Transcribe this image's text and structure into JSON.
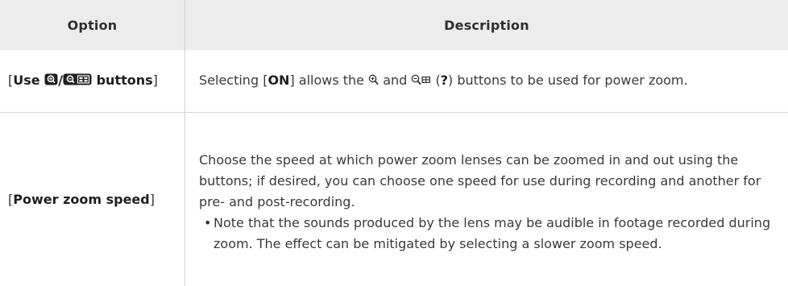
{
  "table": {
    "headers": {
      "option": "Option",
      "description": "Description"
    },
    "rows": [
      {
        "option_prefix": "[",
        "option_bold_a": "Use ",
        "option_icon_a": "zoom-in-button-icon",
        "option_slash": "/",
        "option_icon_b": "zoom-out-index-button-icon",
        "option_bold_b": " buttons",
        "option_suffix": "]",
        "desc_part1": "Selecting [",
        "desc_on": "ON",
        "desc_part2": "] allows the ",
        "desc_icon_a": "zoom-in-glyph",
        "desc_and": " and ",
        "desc_icon_b": "zoom-out-glyph",
        "desc_part3": " (",
        "desc_q": "?",
        "desc_part4": ") buttons to be used for power zoom."
      },
      {
        "option_prefix": "[",
        "option_bold": "Power zoom speed",
        "option_suffix": "]",
        "desc_text": "Choose the speed at which power zoom lenses can be zoomed in and out using the buttons; if desired, you can choose one speed for use during recording and another for pre- and post-recording.",
        "desc_bullet": "Note that the sounds produced by the lens may be audible in footage recorded during zoom. The effect can be mitigated by selecting a slower zoom speed."
      }
    ]
  }
}
